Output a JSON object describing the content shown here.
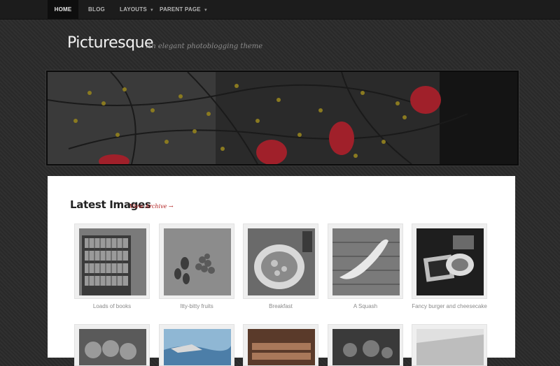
{
  "nav": {
    "items": [
      {
        "label": "HOME",
        "dropdown": false
      },
      {
        "label": "BLOG",
        "dropdown": false
      },
      {
        "label": "LAYOUTS",
        "dropdown": true
      },
      {
        "label": "PARENT PAGE",
        "dropdown": true
      }
    ]
  },
  "site": {
    "title": "Picturesque",
    "tagline": "An elegant photoblogging theme"
  },
  "gallery": {
    "heading": "Latest Images",
    "archive_link": "View Archive →",
    "items": [
      {
        "caption": "Loads of books"
      },
      {
        "caption": "Itty-bitty fruits"
      },
      {
        "caption": "Breakfast"
      },
      {
        "caption": "A Squash"
      },
      {
        "caption": "Fancy burger and cheesecake"
      }
    ]
  },
  "colors": {
    "accent": "#b22222",
    "background": "#2b2b2b",
    "nav": "#1c1c1c"
  }
}
